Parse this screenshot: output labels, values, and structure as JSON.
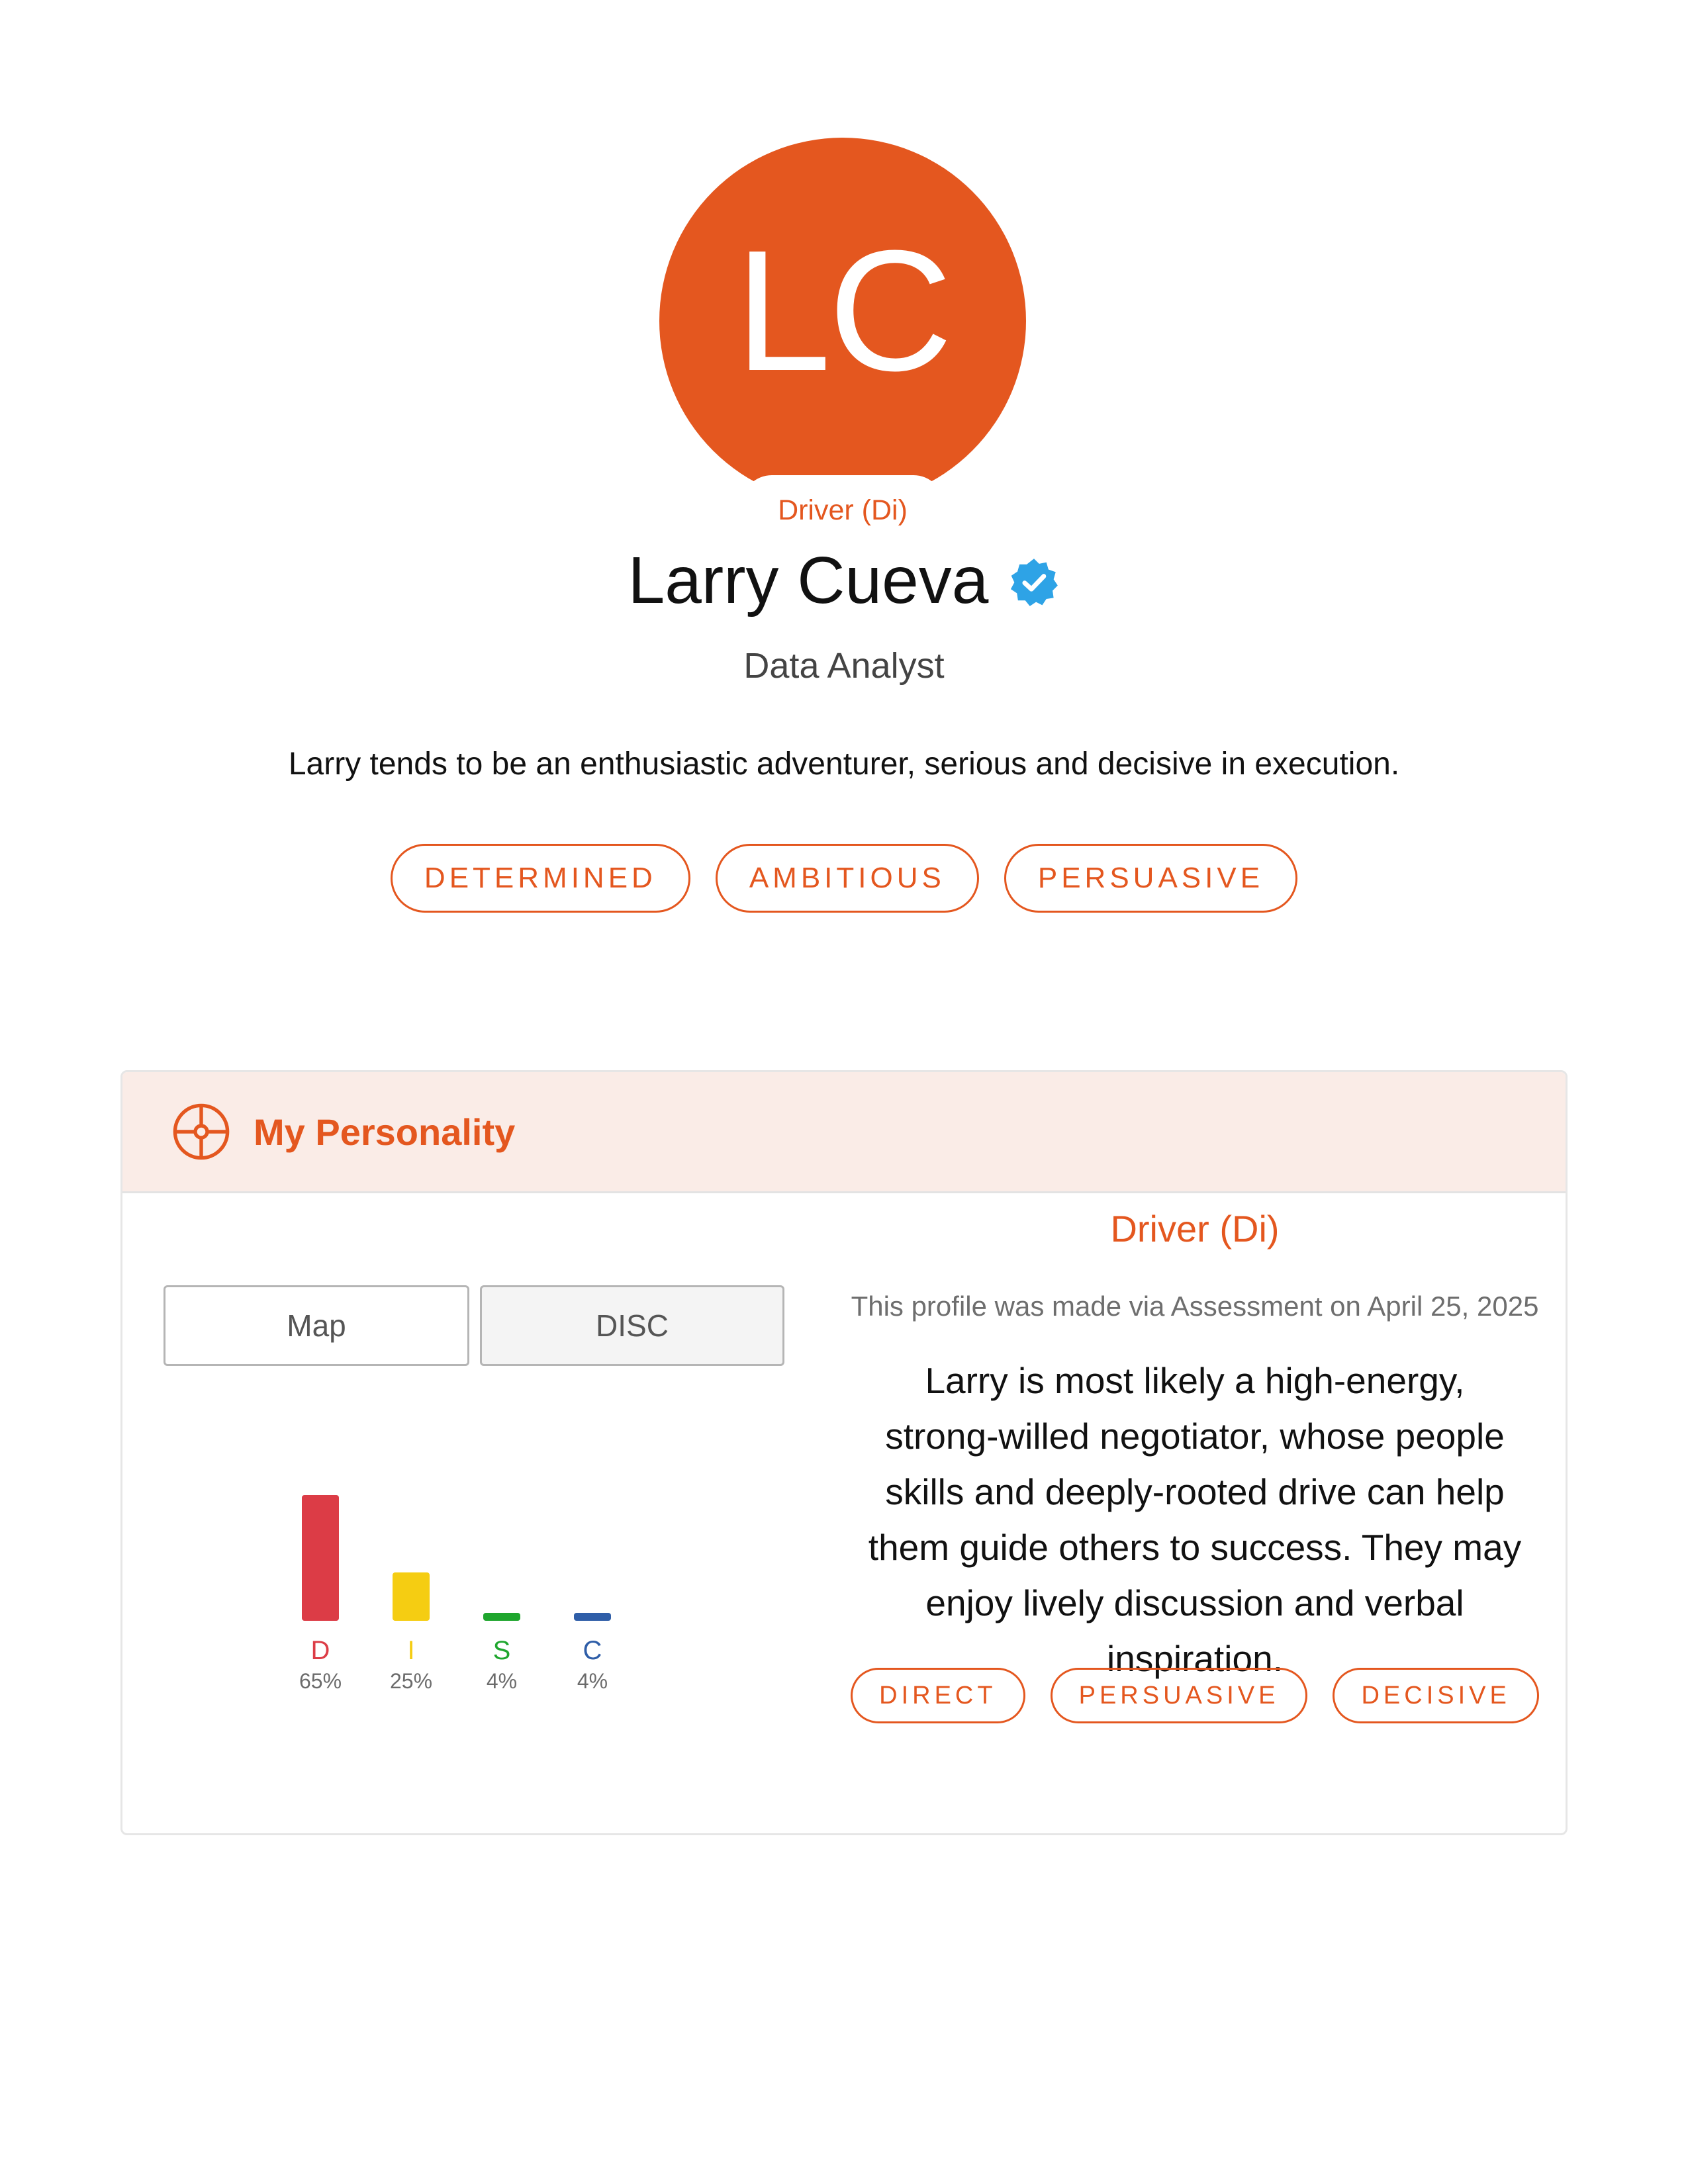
{
  "profile": {
    "initials": "LC",
    "type_label": "Driver (Di)",
    "name": "Larry Cueva",
    "job_title": "Data Analyst",
    "summary": "Larry tends to be an enthusiastic adventurer, serious and decisive in execution.",
    "traits": [
      "DETERMINED",
      "AMBITIOUS",
      "PERSUASIVE"
    ],
    "avatar_color": "#e4571f",
    "verified_icon": "verified-badge-icon"
  },
  "personality": {
    "title": "My Personality",
    "icon": "target-icon",
    "toggle": {
      "map_label": "Map",
      "disc_label": "DISC",
      "selected": "DISC"
    },
    "type_heading": "Driver (Di)",
    "note": "This profile was made via Assessment on April 25, 2025",
    "description": "Larry is most likely a high-energy, strong-willed negotiator, whose people skills and deeply-rooted drive can help them guide others to success. They may enjoy lively discussion and verbal inspiration.",
    "tags": [
      "DIRECT",
      "PERSUASIVE",
      "DECISIVE"
    ]
  },
  "chart_data": {
    "type": "bar",
    "categories": [
      "D",
      "I",
      "S",
      "C"
    ],
    "values": [
      65,
      25,
      4,
      4
    ],
    "value_labels": [
      "65%",
      "25%",
      "4%",
      "4%"
    ],
    "colors": [
      "#dc3c46",
      "#f5cd12",
      "#1fa62e",
      "#2f5ea8"
    ],
    "ylim": [
      0,
      65
    ],
    "grid": false
  }
}
